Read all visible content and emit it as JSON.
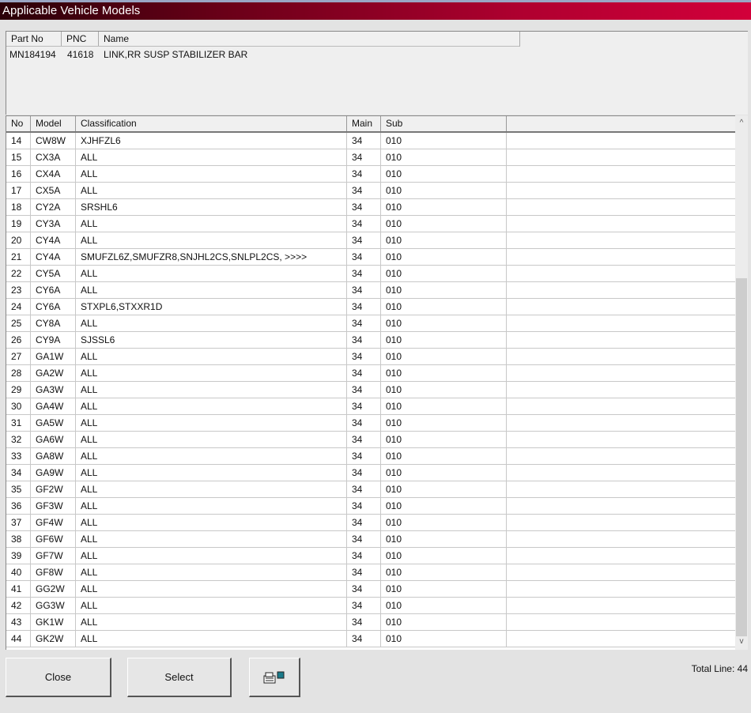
{
  "window": {
    "title": "Applicable Vehicle Models"
  },
  "part": {
    "headers": [
      "Part No",
      "PNC",
      "Name"
    ],
    "row": [
      "MN184194",
      "41618",
      "LINK,RR SUSP STABILIZER BAR"
    ]
  },
  "grid": {
    "headers": [
      "No",
      "Model",
      "Classification",
      "Main",
      "Sub"
    ],
    "rows": [
      [
        "14",
        "CW8W",
        "XJHFZL6",
        "34",
        "010"
      ],
      [
        "15",
        "CX3A",
        "ALL",
        "34",
        "010"
      ],
      [
        "16",
        "CX4A",
        "ALL",
        "34",
        "010"
      ],
      [
        "17",
        "CX5A",
        "ALL",
        "34",
        "010"
      ],
      [
        "18",
        "CY2A",
        "SRSHL6",
        "34",
        "010"
      ],
      [
        "19",
        "CY3A",
        "ALL",
        "34",
        "010"
      ],
      [
        "20",
        "CY4A",
        "ALL",
        "34",
        "010"
      ],
      [
        "21",
        "CY4A",
        "SMUFZL6Z,SMUFZR8,SNJHL2CS,SNLPL2CS,  >>>>",
        "34",
        "010"
      ],
      [
        "22",
        "CY5A",
        "ALL",
        "34",
        "010"
      ],
      [
        "23",
        "CY6A",
        "ALL",
        "34",
        "010"
      ],
      [
        "24",
        "CY6A",
        "STXPL6,STXXR1D",
        "34",
        "010"
      ],
      [
        "25",
        "CY8A",
        "ALL",
        "34",
        "010"
      ],
      [
        "26",
        "CY9A",
        "SJSSL6",
        "34",
        "010"
      ],
      [
        "27",
        "GA1W",
        "ALL",
        "34",
        "010"
      ],
      [
        "28",
        "GA2W",
        "ALL",
        "34",
        "010"
      ],
      [
        "29",
        "GA3W",
        "ALL",
        "34",
        "010"
      ],
      [
        "30",
        "GA4W",
        "ALL",
        "34",
        "010"
      ],
      [
        "31",
        "GA5W",
        "ALL",
        "34",
        "010"
      ],
      [
        "32",
        "GA6W",
        "ALL",
        "34",
        "010"
      ],
      [
        "33",
        "GA8W",
        "ALL",
        "34",
        "010"
      ],
      [
        "34",
        "GA9W",
        "ALL",
        "34",
        "010"
      ],
      [
        "35",
        "GF2W",
        "ALL",
        "34",
        "010"
      ],
      [
        "36",
        "GF3W",
        "ALL",
        "34",
        "010"
      ],
      [
        "37",
        "GF4W",
        "ALL",
        "34",
        "010"
      ],
      [
        "38",
        "GF6W",
        "ALL",
        "34",
        "010"
      ],
      [
        "39",
        "GF7W",
        "ALL",
        "34",
        "010"
      ],
      [
        "40",
        "GF8W",
        "ALL",
        "34",
        "010"
      ],
      [
        "41",
        "GG2W",
        "ALL",
        "34",
        "010"
      ],
      [
        "42",
        "GG3W",
        "ALL",
        "34",
        "010"
      ],
      [
        "43",
        "GK1W",
        "ALL",
        "34",
        "010"
      ],
      [
        "44",
        "GK2W",
        "ALL",
        "34",
        "010"
      ]
    ]
  },
  "scroll": {
    "position_fraction": 1.0
  },
  "buttons": {
    "close": "Close",
    "select": "Select",
    "print_icon": "printer-icon"
  },
  "status": {
    "total_line": "Total Line: 44"
  }
}
